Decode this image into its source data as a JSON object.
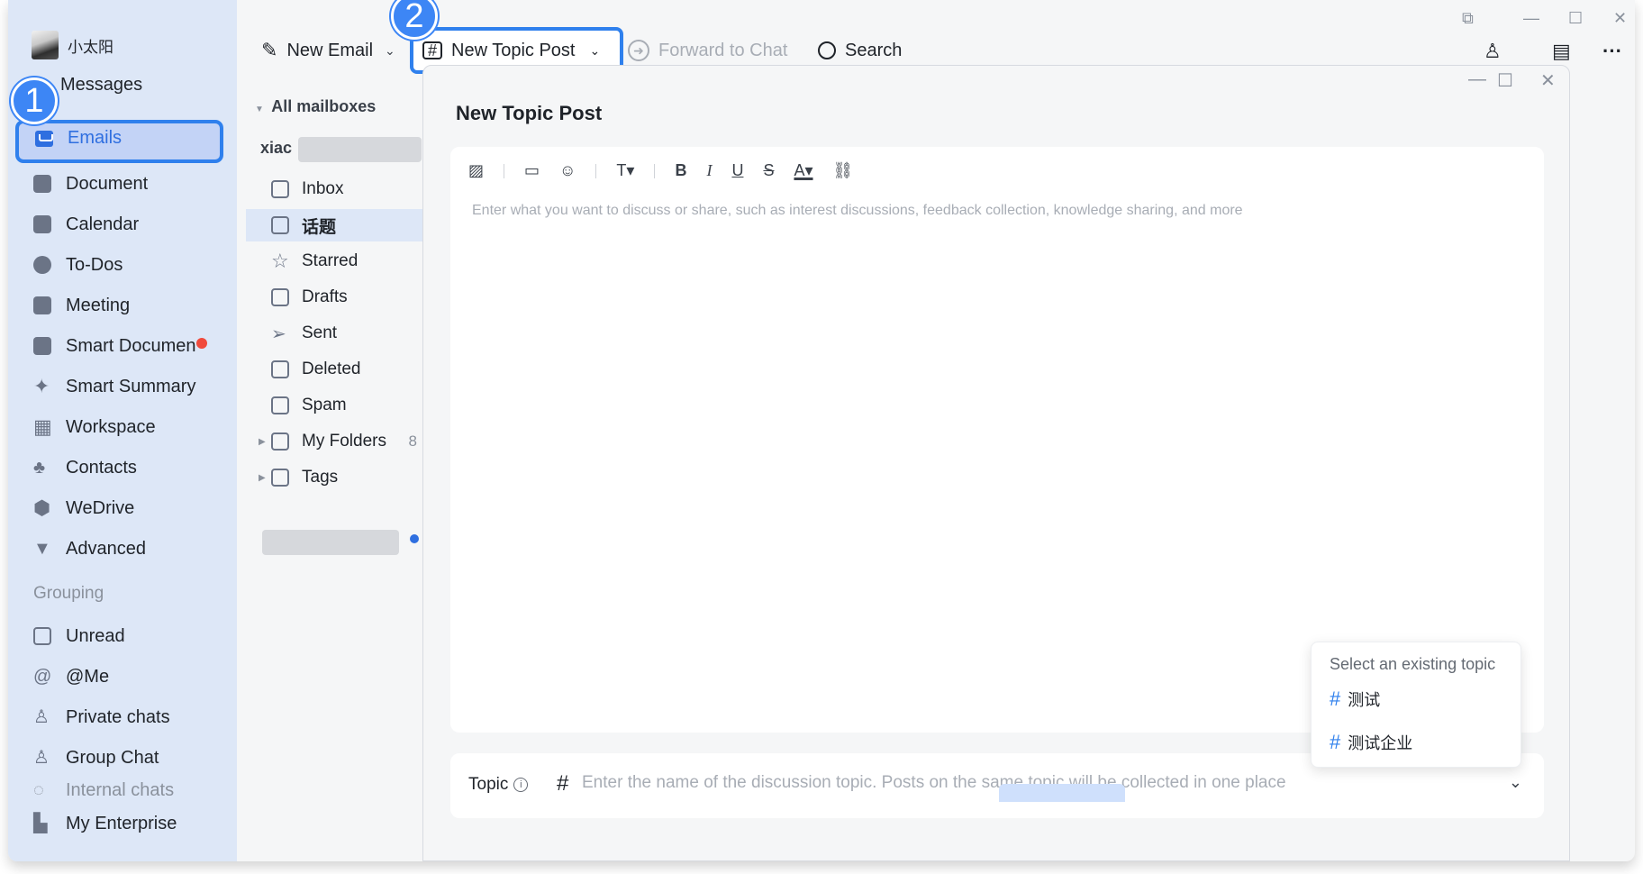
{
  "user": {
    "name": "小太阳"
  },
  "steps": {
    "one": "1",
    "two": "2"
  },
  "sidebar": {
    "items": [
      {
        "label": "Messages",
        "icon": "chat-icon"
      },
      {
        "label": "Emails",
        "icon": "mail-icon"
      },
      {
        "label": "Document",
        "icon": "document-icon"
      },
      {
        "label": "Calendar",
        "icon": "calendar-icon"
      },
      {
        "label": "To-Dos",
        "icon": "check-circle-icon"
      },
      {
        "label": "Meeting",
        "icon": "meeting-icon"
      },
      {
        "label": "Smart Documen",
        "icon": "smart-document-icon"
      },
      {
        "label": "Smart Summary",
        "icon": "sparkle-icon"
      },
      {
        "label": "Workspace",
        "icon": "grid-icon"
      },
      {
        "label": "Contacts",
        "icon": "org-chart-icon"
      },
      {
        "label": "WeDrive",
        "icon": "drive-icon"
      },
      {
        "label": "Advanced",
        "icon": "advanced-icon"
      }
    ],
    "grouping_label": "Grouping",
    "groups": [
      {
        "label": "Unread",
        "icon": "unread-icon"
      },
      {
        "label": "@Me",
        "icon": "at-icon"
      },
      {
        "label": "Private chats",
        "icon": "person-icon"
      },
      {
        "label": "Group Chat",
        "icon": "group-icon"
      },
      {
        "label": "Internal chats",
        "icon": "internal-chat-icon"
      },
      {
        "label": "My Enterprise",
        "icon": "enterprise-icon"
      }
    ]
  },
  "toolbar": {
    "new_email": "New Email",
    "new_topic_post": "New Topic Post",
    "forward_to_chat": "Forward to Chat",
    "search": "Search"
  },
  "mailboxes": {
    "header": "All mailboxes",
    "account": "xiac",
    "items": [
      {
        "label": "Inbox",
        "icon": "inbox-icon"
      },
      {
        "label": "话题",
        "icon": "hash-icon"
      },
      {
        "label": "Starred",
        "icon": "star-icon"
      },
      {
        "label": "Drafts",
        "icon": "draft-icon"
      },
      {
        "label": "Sent",
        "icon": "send-icon"
      },
      {
        "label": "Deleted",
        "icon": "trash-icon"
      },
      {
        "label": "Spam",
        "icon": "spam-icon"
      },
      {
        "label": "My Folders",
        "icon": "folder-icon",
        "count": "8"
      },
      {
        "label": "Tags",
        "icon": "tag-icon"
      }
    ]
  },
  "compose": {
    "title": "New Topic Post",
    "placeholder": "Enter what you want to discuss or share, such as interest discussions, feedback collection, knowledge sharing, and more",
    "topic_label": "Topic",
    "topic_hash": "#",
    "topic_placeholder": "Enter the name of the discussion topic. Posts on the same topic will be collected in one place",
    "dropdown": {
      "header": "Select an existing topic",
      "options": [
        "测试",
        "测试企业"
      ]
    }
  },
  "colors": {
    "accent": "#2f80ed",
    "sidebar_bg": "#dde7f7",
    "badge": "#f04a3c"
  }
}
